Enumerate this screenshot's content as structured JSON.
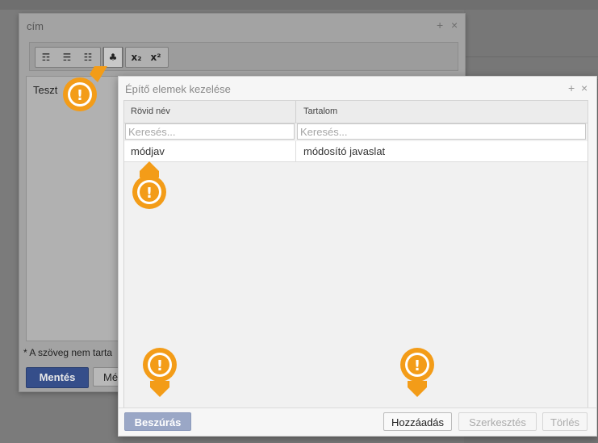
{
  "back_dialog": {
    "title": "cím",
    "add_icon": "+",
    "close_icon": "×",
    "toolbar": {
      "buttons": [
        {
          "icon": "insert-field-icon",
          "glyph": "☶"
        },
        {
          "icon": "insert-field-alt-icon",
          "glyph": "☴"
        },
        {
          "icon": "remove-field-icon",
          "glyph": "☷"
        },
        {
          "icon": "building-blocks-icon",
          "glyph": "♣"
        },
        {
          "icon": "subscript-icon",
          "glyph": "x₂"
        },
        {
          "icon": "superscript-icon",
          "glyph": "x²"
        }
      ]
    },
    "editor_text": "Teszt",
    "note": "* A szöveg nem tarta",
    "save_label": "Mentés",
    "cancel_label": "Mégs"
  },
  "front_dialog": {
    "title": "Építő elemek kezelése",
    "add_icon": "+",
    "close_icon": "×",
    "columns": [
      "Rövid név",
      "Tartalom"
    ],
    "filters": {
      "short_name_placeholder": "Keresés...",
      "content_placeholder": "Keresés..."
    },
    "rows": [
      {
        "short_name": "módjav",
        "content": "módosító javaslat"
      }
    ],
    "buttons": {
      "insert": "Beszúrás",
      "add": "Hozzáadás",
      "edit": "Szerkesztés",
      "delete": "Törlés"
    }
  },
  "hint_markers": [
    {
      "name": "toolbar-hint",
      "symbol": "!"
    },
    {
      "name": "row-hint",
      "symbol": "!"
    },
    {
      "name": "insert-hint",
      "symbol": "!"
    },
    {
      "name": "add-hint",
      "symbol": "!"
    }
  ],
  "colors": {
    "accent": "#354e8a",
    "marker": "#f39c18"
  }
}
